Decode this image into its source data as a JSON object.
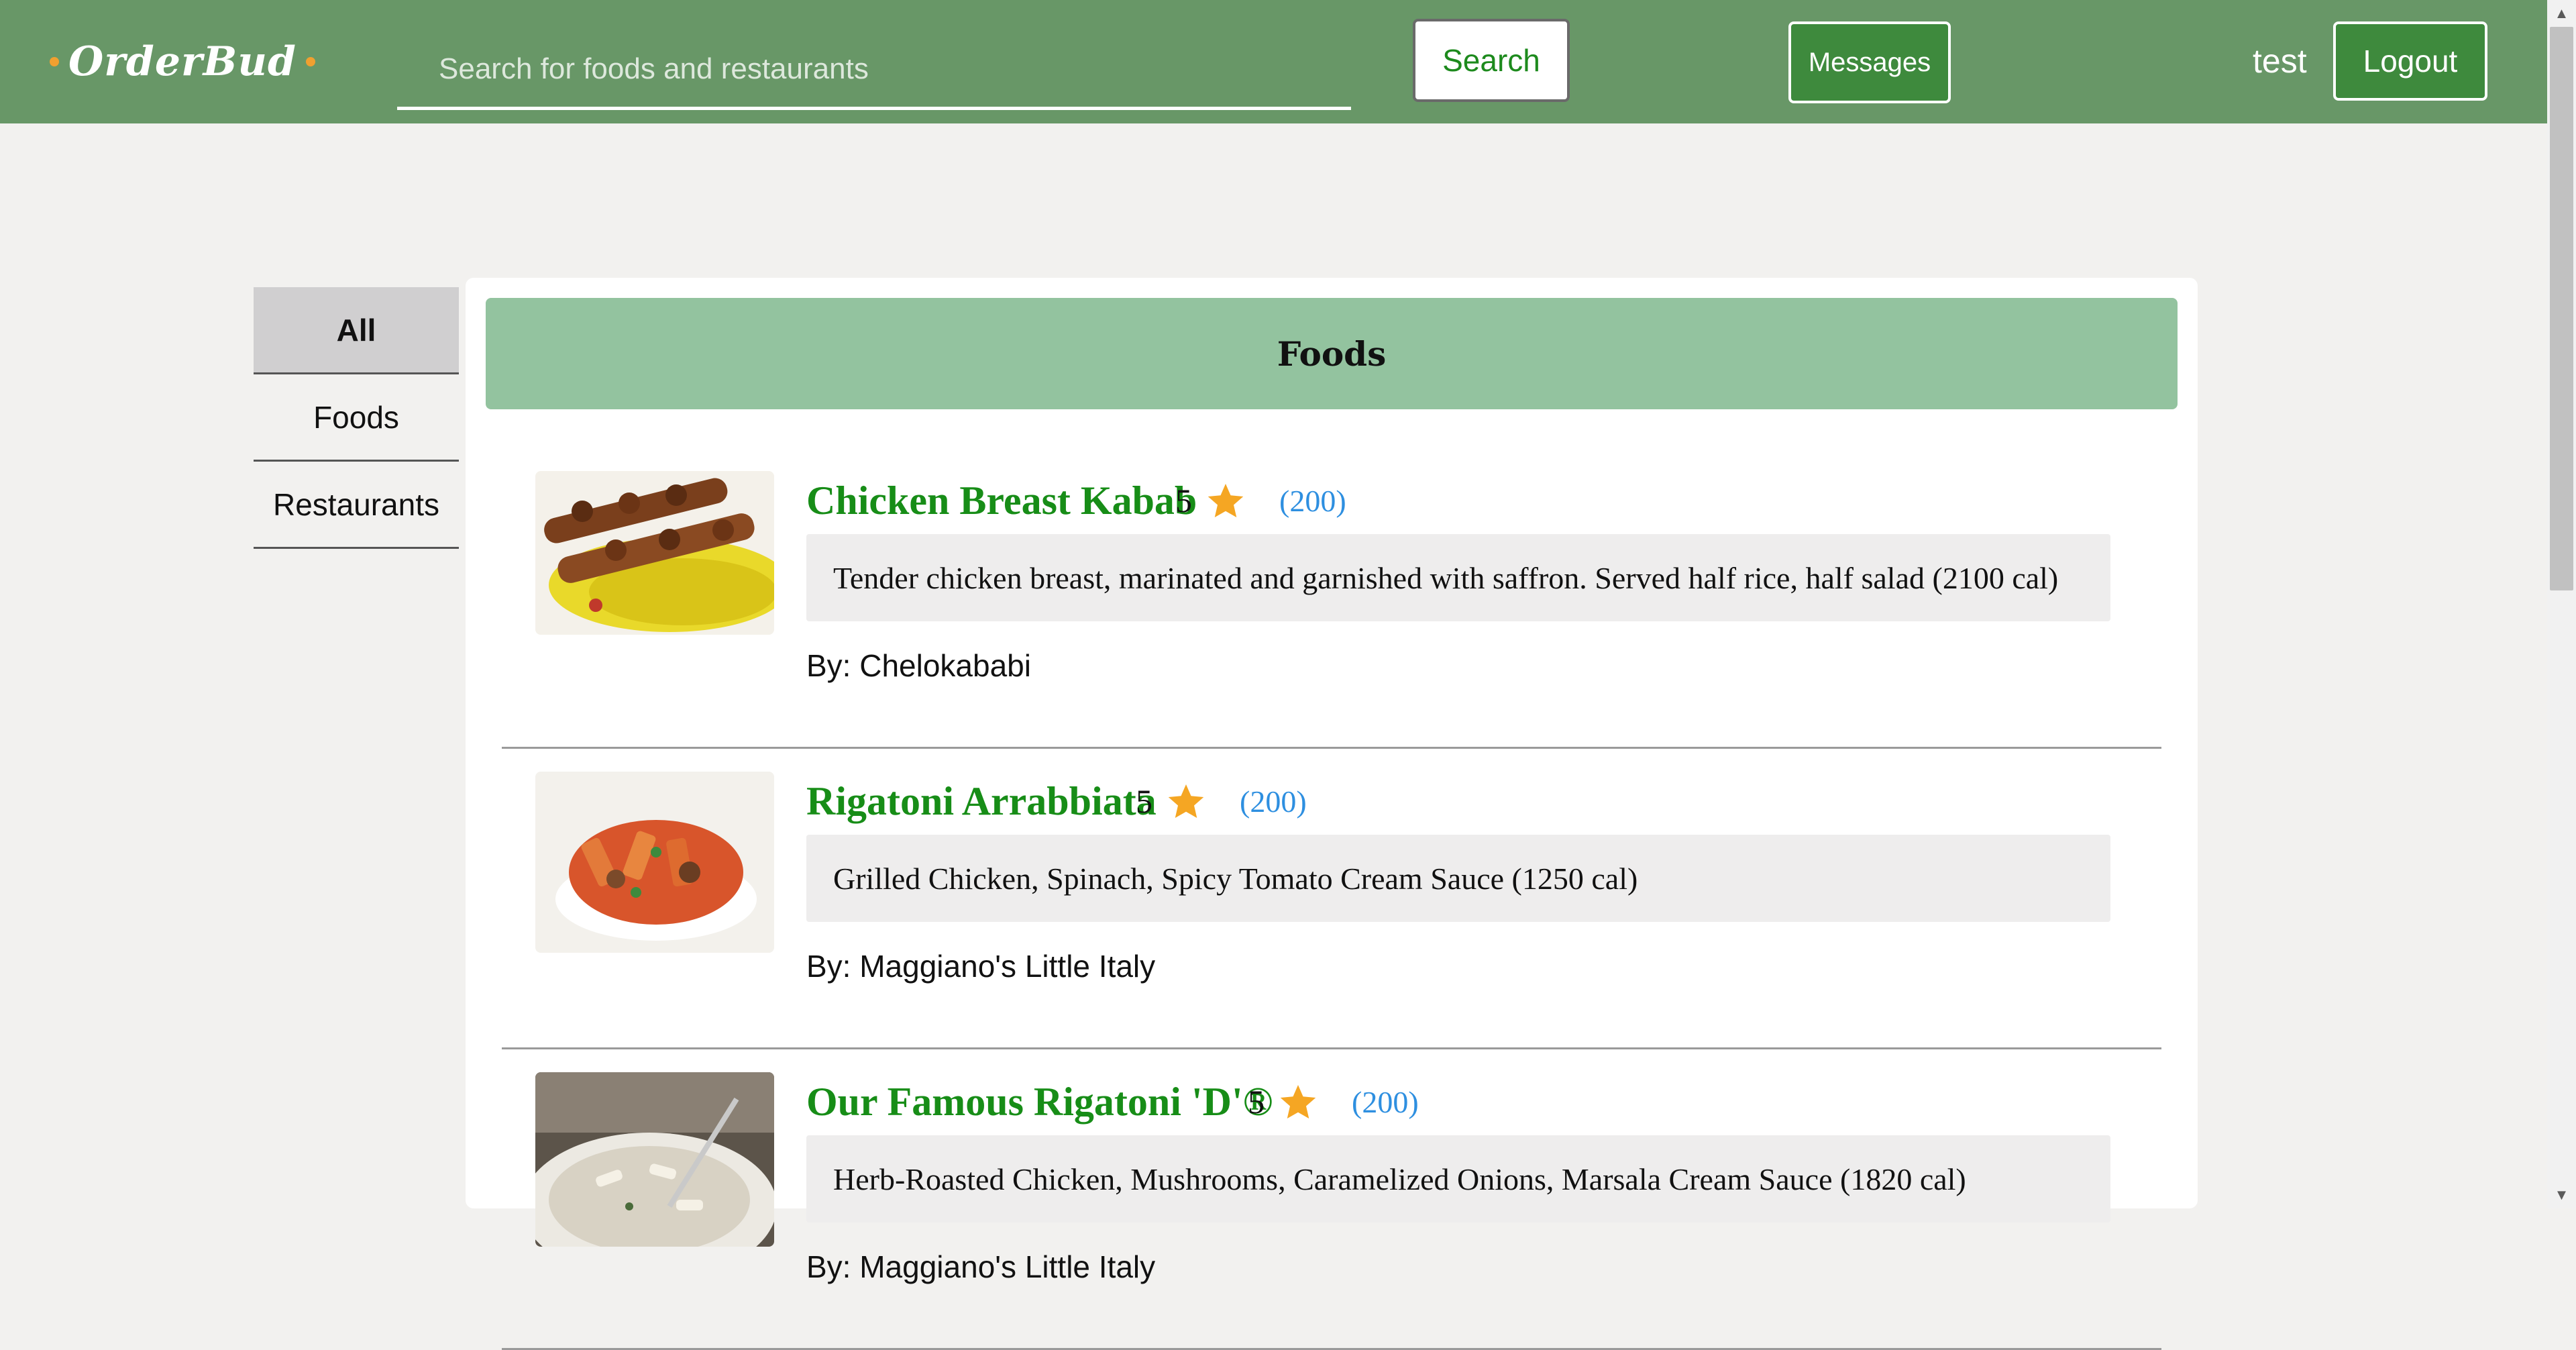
{
  "header": {
    "logo_text": "OrderBud",
    "search_placeholder": "Search for foods and restaurants",
    "search_value": "",
    "search_label": "Search",
    "messages_label": "Messages",
    "username": "test",
    "logout_label": "Logout"
  },
  "sidebar": {
    "items": [
      {
        "label": "All",
        "active": true
      },
      {
        "label": "Foods",
        "active": false
      },
      {
        "label": "Restaurants",
        "active": false
      }
    ]
  },
  "main": {
    "title": "Foods",
    "foods": [
      {
        "name": "Chicken Breast Kabab",
        "rating": "5",
        "reviews": "(200)",
        "description": "Tender chicken breast, marinated and garnished with saffron. Served half rice, half salad (2100 cal)",
        "by": "By: Chelokababi"
      },
      {
        "name": "Rigatoni Arrabbiata",
        "rating": "5",
        "reviews": "(200)",
        "description": "Grilled Chicken, Spinach, Spicy Tomato Cream Sauce (1250 cal)",
        "by": "By: Maggiano's Little Italy"
      },
      {
        "name": "Our Famous Rigatoni 'D'®",
        "rating": "5",
        "reviews": "(200)",
        "description": "Herb-Roasted Chicken, Mushrooms, Caramelized Onions, Marsala Cream Sauce (1820 cal)",
        "by": "By: Maggiano's Little Italy"
      }
    ]
  },
  "colors": {
    "header_bg": "#689767",
    "accent_green": "#178d17",
    "panel_header_bg": "#93c39f",
    "star": "#f5a623",
    "review_link": "#2e8fe0"
  }
}
